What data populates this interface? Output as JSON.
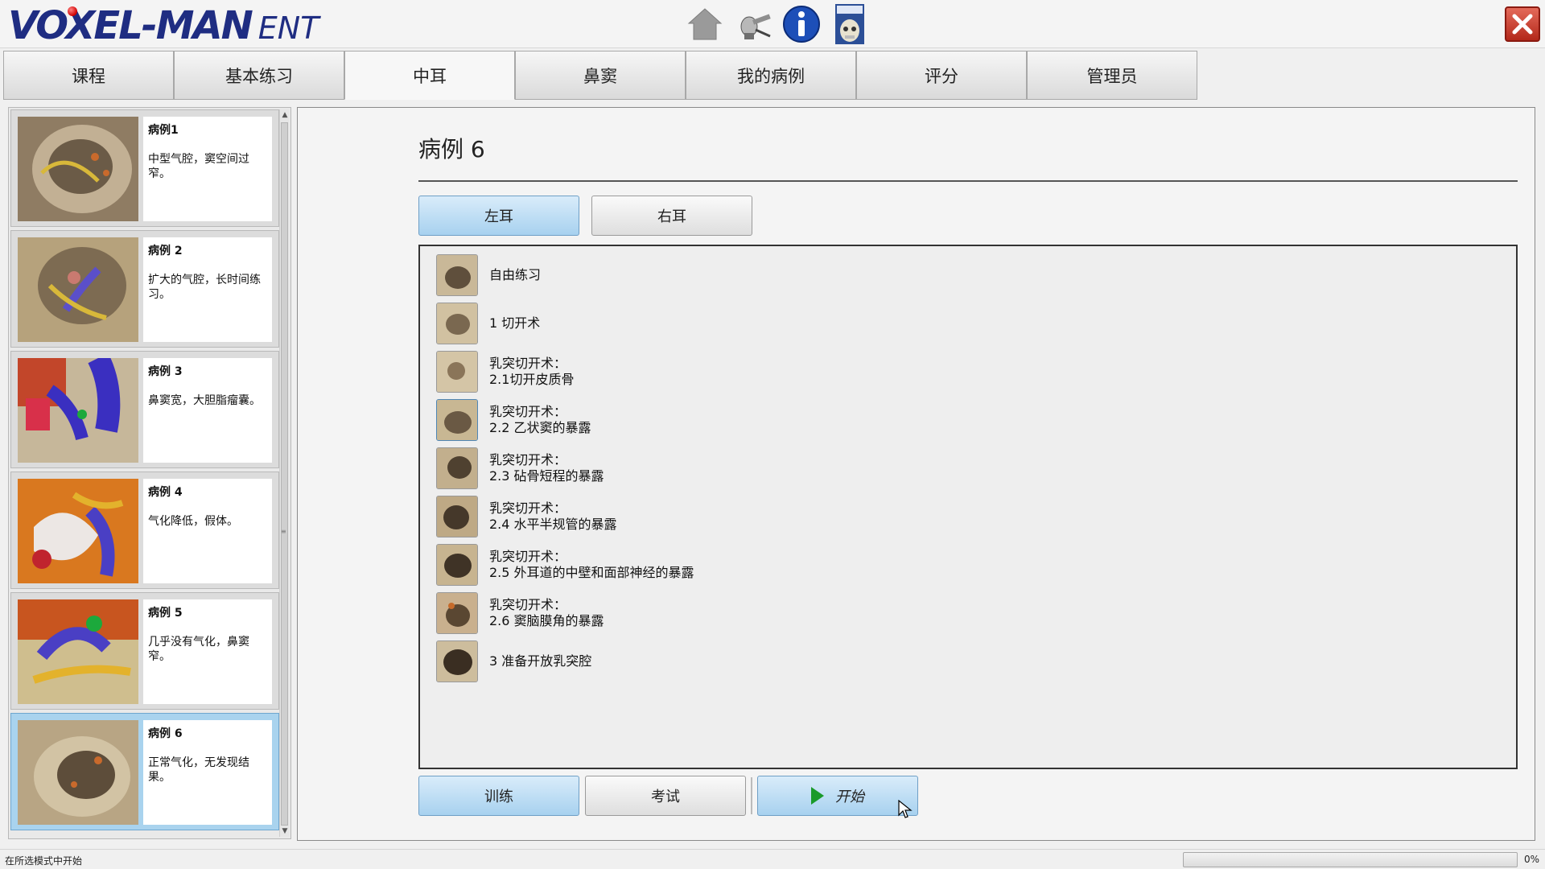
{
  "app": {
    "logo_main": "VOXEL-MAN",
    "logo_sub": "ENT",
    "icons": [
      "home-icon",
      "instrument-icon",
      "info-icon",
      "atlas-book-icon"
    ],
    "close_icon": "close-icon"
  },
  "tabs": [
    {
      "label": "课程",
      "active": false
    },
    {
      "label": "基本练习",
      "active": false
    },
    {
      "label": "中耳",
      "active": true
    },
    {
      "label": "鼻窦",
      "active": false
    },
    {
      "label": "我的病例",
      "active": false
    },
    {
      "label": "评分",
      "active": false
    },
    {
      "label": "管理员",
      "active": false
    }
  ],
  "cases": [
    {
      "title": "病例1",
      "desc": "中型气腔，窦空间过窄。",
      "selected": false
    },
    {
      "title": "病例 2",
      "desc": "扩大的气腔，长时间练习。",
      "selected": false
    },
    {
      "title": "病例 3",
      "desc": "鼻窦宽，大胆脂瘤囊。",
      "selected": false
    },
    {
      "title": "病例 4",
      "desc": "气化降低，假体。",
      "selected": false
    },
    {
      "title": "病例 5",
      "desc": "几乎没有气化，鼻窦窄。",
      "selected": false
    },
    {
      "title": "病例 6",
      "desc": "正常气化，无发现结果。",
      "selected": true
    }
  ],
  "main": {
    "title": "病例 6",
    "left_ear": "左耳",
    "right_ear": "右耳",
    "steps": [
      {
        "line1": "自由练习",
        "line2": ""
      },
      {
        "line1": "1 切开术",
        "line2": ""
      },
      {
        "line1": "乳突切开术：",
        "line2": "2.1切开皮质骨"
      },
      {
        "line1": "乳突切开术：",
        "line2": "2.2 乙状窦的暴露"
      },
      {
        "line1": "乳突切开术：",
        "line2": "2.3 砧骨短程的暴露"
      },
      {
        "line1": "乳突切开术：",
        "line2": "2.4 水平半规管的暴露"
      },
      {
        "line1": "乳突切开术：",
        "line2": "2.5 外耳道的中壁和面部神经的暴露"
      },
      {
        "line1": "乳突切开术：",
        "line2": "2.6 窦脑膜角的暴露"
      },
      {
        "line1": "3 准备开放乳突腔",
        "line2": ""
      }
    ],
    "train": "训练",
    "exam": "考试",
    "start": "开始"
  },
  "status": {
    "message": "在所选模式中开始",
    "progress_pct": "0%",
    "progress": 0
  }
}
